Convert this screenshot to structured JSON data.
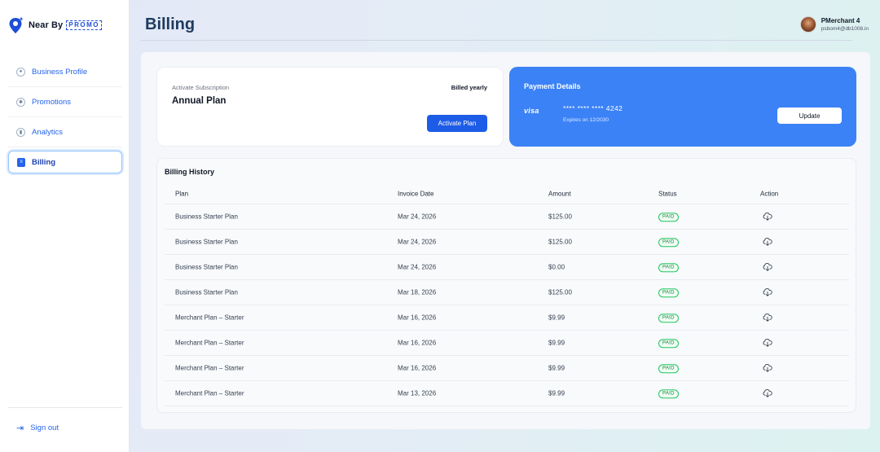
{
  "brand": {
    "name": "Near By",
    "tag": "PROMO",
    "pin_color": "#1d4ed8"
  },
  "sidebar": {
    "items": [
      {
        "label": "Business Profile",
        "icon": "user-circle-icon",
        "active": false
      },
      {
        "label": "Promotions",
        "icon": "gear-badge-icon",
        "active": false
      },
      {
        "label": "Analytics",
        "icon": "chart-icon",
        "active": false
      },
      {
        "label": "Billing",
        "icon": "document-icon",
        "active": true
      }
    ],
    "signout_label": "Sign out"
  },
  "header": {
    "title": "Billing"
  },
  "user": {
    "name": "PMerchant 4",
    "email": "psbom4@db1008.in"
  },
  "subscription": {
    "label": "Activate Subscription",
    "plan": "Annual Plan",
    "billing_cycle": "Billed yearly",
    "button_label": "Activate Plan"
  },
  "payment": {
    "title": "Payment Details",
    "brand": "visa",
    "card_number": "**** **** **** 4242",
    "expiry": "Expires on 12/2030",
    "button_label": "Update",
    "card_color": "#3b82f6"
  },
  "billing_history": {
    "title": "Billing History",
    "columns": [
      "Plan",
      "Invoice Date",
      "Amount",
      "Status",
      "Action"
    ],
    "rows": [
      {
        "plan": "Business Starter Plan",
        "date": "Mar 24, 2026",
        "amount": "$125.00",
        "status": "PAID"
      },
      {
        "plan": "Business Starter Plan",
        "date": "Mar 24, 2026",
        "amount": "$125.00",
        "status": "PAID"
      },
      {
        "plan": "Business Starter Plan",
        "date": "Mar 24, 2026",
        "amount": "$0.00",
        "status": "PAID"
      },
      {
        "plan": "Business Starter Plan",
        "date": "Mar 18, 2026",
        "amount": "$125.00",
        "status": "PAID"
      },
      {
        "plan": "Merchant Plan – Starter",
        "date": "Mar 16, 2026",
        "amount": "$9.99",
        "status": "PAID"
      },
      {
        "plan": "Merchant Plan – Starter",
        "date": "Mar 16, 2026",
        "amount": "$9.99",
        "status": "PAID"
      },
      {
        "plan": "Merchant Plan – Starter",
        "date": "Mar 16, 2026",
        "amount": "$9.99",
        "status": "PAID"
      },
      {
        "plan": "Merchant Plan – Starter",
        "date": "Mar 13, 2026",
        "amount": "$9.99",
        "status": "PAID"
      }
    ],
    "status_color": "#15803d"
  }
}
